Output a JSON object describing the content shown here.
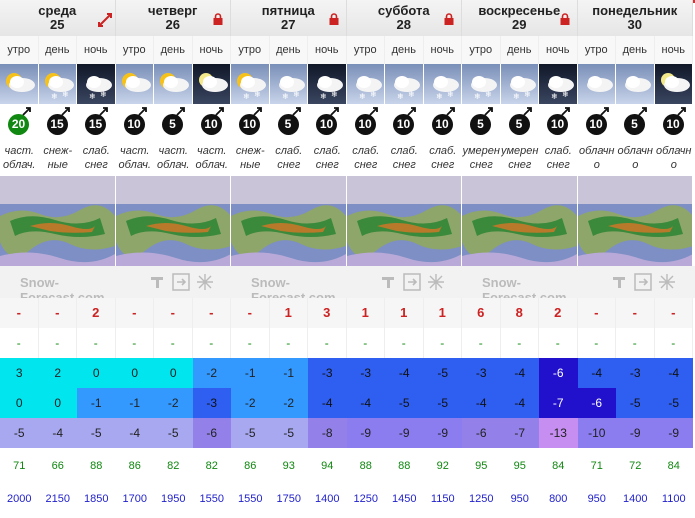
{
  "days": [
    {
      "name": "среда",
      "num": "25",
      "badge": "expand-arrows-icon"
    },
    {
      "name": "четверг",
      "num": "26",
      "badge": "lock-icon"
    },
    {
      "name": "пятница",
      "num": "27",
      "badge": "lock-icon"
    },
    {
      "name": "суббота",
      "num": "28",
      "badge": "lock-icon"
    },
    {
      "name": "воскресенье",
      "num": "29",
      "badge": "lock-icon"
    },
    {
      "name": "понедельник",
      "num": "30",
      "badge": ""
    }
  ],
  "periods": [
    "утро",
    "день",
    "ночь",
    "утро",
    "день",
    "ночь",
    "утро",
    "день",
    "ночь",
    "утро",
    "день",
    "ночь",
    "утро",
    "день",
    "ночь",
    "утро",
    "день",
    "ночь"
  ],
  "icons": [
    "sun-cloud-icon",
    "sun-cloud-snow-icon",
    "cloud-snow-night-icon",
    "sun-cloud-icon",
    "sun-cloud-icon",
    "moon-cloud-icon",
    "sun-cloud-snow-icon",
    "cloud-snow-icon",
    "cloud-snow-night-icon",
    "cloud-snow-icon",
    "cloud-snow-icon",
    "cloud-snow-icon",
    "cloud-snow-icon",
    "cloud-snow-icon",
    "cloud-snow-night-icon",
    "cloud-icon",
    "cloud-icon",
    "moon-cloud-icon"
  ],
  "wind": [
    {
      "v": "20",
      "green": true
    },
    {
      "v": "15"
    },
    {
      "v": "15"
    },
    {
      "v": "10"
    },
    {
      "v": "5"
    },
    {
      "v": "10"
    },
    {
      "v": "10"
    },
    {
      "v": "5"
    },
    {
      "v": "10"
    },
    {
      "v": "10"
    },
    {
      "v": "10"
    },
    {
      "v": "10"
    },
    {
      "v": "5"
    },
    {
      "v": "5"
    },
    {
      "v": "10"
    },
    {
      "v": "10"
    },
    {
      "v": "5"
    },
    {
      "v": "10"
    }
  ],
  "desc": [
    [
      "част.",
      "облач."
    ],
    [
      "снеж-",
      "ные"
    ],
    [
      "слаб.",
      "снег"
    ],
    [
      "част.",
      "облач."
    ],
    [
      "част.",
      "облач."
    ],
    [
      "част.",
      "облач."
    ],
    [
      "снеж-",
      "ные"
    ],
    [
      "слаб.",
      "снег"
    ],
    [
      "слаб.",
      "снег"
    ],
    [
      "слаб.",
      "снег"
    ],
    [
      "слаб.",
      "снег"
    ],
    [
      "слаб.",
      "снег"
    ],
    [
      "умерен",
      "снег"
    ],
    [
      "умерен",
      "снег"
    ],
    [
      "слаб.",
      "снег"
    ],
    [
      "облачн",
      "о"
    ],
    [
      "облачн",
      "о"
    ],
    [
      "облачн",
      "о"
    ]
  ],
  "brand": "Snow-Forecast.com",
  "snow": [
    "-",
    "-",
    "2",
    "-",
    "-",
    "-",
    "-",
    "1",
    "3",
    "1",
    "1",
    "1",
    "6",
    "8",
    "2",
    "-",
    "-",
    "-"
  ],
  "rain": [
    "-",
    "-",
    "-",
    "-",
    "-",
    "-",
    "-",
    "-",
    "-",
    "-",
    "-",
    "-",
    "-",
    "-",
    "-",
    "-",
    "-",
    "-"
  ],
  "tmax": [
    "3",
    "2",
    "0",
    "0",
    "0",
    "-2",
    "-1",
    "-1",
    "-3",
    "-3",
    "-4",
    "-5",
    "-3",
    "-4",
    "-6",
    "-4",
    "-3",
    "-4"
  ],
  "tmin": [
    "0",
    "0",
    "-1",
    "-1",
    "-2",
    "-3",
    "-2",
    "-2",
    "-4",
    "-4",
    "-5",
    "-5",
    "-4",
    "-4",
    "-7",
    "-6",
    "-5",
    "-5"
  ],
  "tchill": [
    "-5",
    "-4",
    "-5",
    "-4",
    "-5",
    "-6",
    "-5",
    "-5",
    "-8",
    "-9",
    "-9",
    "-9",
    "-6",
    "-7",
    "-13",
    "-10",
    "-9",
    "-9"
  ],
  "humidity": [
    "71",
    "66",
    "88",
    "86",
    "82",
    "82",
    "86",
    "93",
    "94",
    "88",
    "88",
    "92",
    "95",
    "95",
    "84",
    "71",
    "72",
    "84"
  ],
  "freezing": [
    "2000",
    "2150",
    "1850",
    "1700",
    "1950",
    "1550",
    "1550",
    "1750",
    "1400",
    "1250",
    "1450",
    "1150",
    "1250",
    "950",
    "800",
    "950",
    "1400",
    "1100"
  ],
  "colors": {
    "lock": "#cc2222",
    "snow": "#cc2222",
    "green": "#118811",
    "blue": "#2222cc"
  }
}
